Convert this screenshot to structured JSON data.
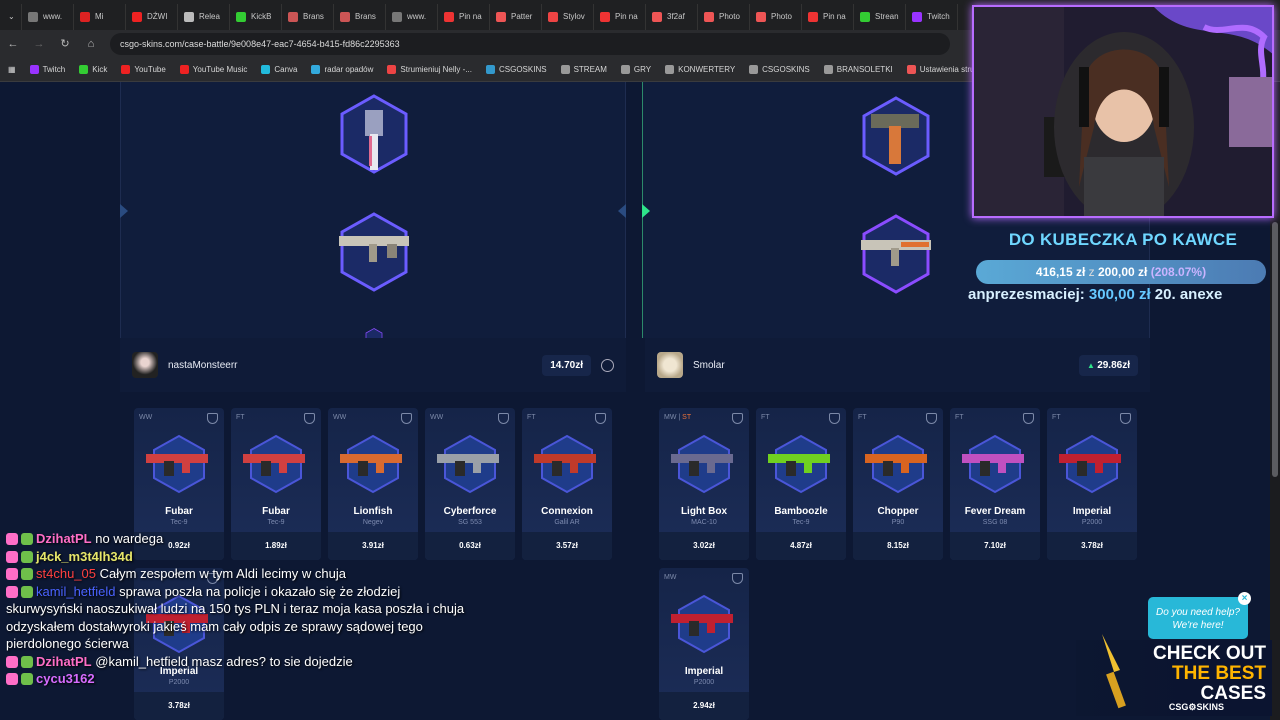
{
  "browser": {
    "tabs": [
      {
        "label": "www.",
        "color": "#777"
      },
      {
        "label": "Mi",
        "color": "#d22"
      },
      {
        "label": "DŹWI",
        "color": "#e22"
      },
      {
        "label": "Relea",
        "color": "#bbb"
      },
      {
        "label": "KickB",
        "color": "#3c3"
      },
      {
        "label": "Brans",
        "color": "#c55"
      },
      {
        "label": "Brans",
        "color": "#c55"
      },
      {
        "label": "www.",
        "color": "#777"
      },
      {
        "label": "Pin na",
        "color": "#e33"
      },
      {
        "label": "Patter",
        "color": "#e55"
      },
      {
        "label": "Stylov",
        "color": "#e44"
      },
      {
        "label": "Pin na",
        "color": "#e33"
      },
      {
        "label": "3f2af",
        "color": "#e55"
      },
      {
        "label": "Photo",
        "color": "#e55"
      },
      {
        "label": "Photo",
        "color": "#e55"
      },
      {
        "label": "Pin na",
        "color": "#e33"
      },
      {
        "label": "Strean",
        "color": "#3c3"
      },
      {
        "label": "Twitch",
        "color": "#93f"
      }
    ],
    "url": "csgo-skins.com/case-battle/9e008e47-eac7-4654-b415-fd86c2295363",
    "bookmarks": [
      {
        "label": "Twitch",
        "color": "#93f"
      },
      {
        "label": "Kick",
        "color": "#3c3"
      },
      {
        "label": "YouTube",
        "color": "#e22"
      },
      {
        "label": "YouTube Music",
        "color": "#e22"
      },
      {
        "label": "Canva",
        "color": "#2bd"
      },
      {
        "label": "radar opadów",
        "color": "#3ad"
      },
      {
        "label": "Strumieniuj Nelly -...",
        "color": "#e44"
      },
      {
        "label": "CSGOSKINS",
        "color": "#39c"
      },
      {
        "label": "STREAM",
        "color": "#999"
      },
      {
        "label": "GRY",
        "color": "#999"
      },
      {
        "label": "KONWERTERY",
        "color": "#999"
      },
      {
        "label": "CSGOSKINS",
        "color": "#999"
      },
      {
        "label": "BRANSOLETKI",
        "color": "#999"
      },
      {
        "label": "Ustawienia strumien...",
        "color": "#e55"
      }
    ]
  },
  "players": [
    {
      "name": "nastaMonsteerr",
      "total": "14.70zł",
      "items": [
        {
          "cond": "WW",
          "st": "",
          "name": "Fubar",
          "sub": "Tec-9",
          "price": "0.92zł",
          "accent": "#d04040"
        },
        {
          "cond": "FT",
          "st": "",
          "name": "Fubar",
          "sub": "Tec-9",
          "price": "1.89zł",
          "accent": "#d04040"
        },
        {
          "cond": "WW",
          "st": "",
          "name": "Lionfish",
          "sub": "Negev",
          "price": "3.91zł",
          "accent": "#d86a30"
        },
        {
          "cond": "WW",
          "st": "",
          "name": "Cyberforce",
          "sub": "SG 553",
          "price": "0.63zł",
          "accent": "#9aa0a8"
        },
        {
          "cond": "FT",
          "st": "",
          "name": "Connexion",
          "sub": "Galil AR",
          "price": "3.57zł",
          "accent": "#c03a2a"
        },
        {
          "cond": "",
          "st": "",
          "name": "Imperial",
          "sub": "P2000",
          "price": "3.78zł",
          "accent": "#c02030"
        }
      ]
    },
    {
      "name": "Smolar",
      "total": "29.86zł",
      "items": [
        {
          "cond": "MW | ",
          "st": "ST",
          "name": "Light Box",
          "sub": "MAC-10",
          "price": "3.02zł",
          "accent": "#6a6a90"
        },
        {
          "cond": "FT",
          "st": "",
          "name": "Bamboozle",
          "sub": "Tec-9",
          "price": "4.87zł",
          "accent": "#70d020"
        },
        {
          "cond": "FT",
          "st": "",
          "name": "Chopper",
          "sub": "P90",
          "price": "8.15zł",
          "accent": "#d86420"
        },
        {
          "cond": "FT",
          "st": "",
          "name": "Fever Dream",
          "sub": "SSG 08",
          "price": "7.10zł",
          "accent": "#c050c0"
        },
        {
          "cond": "FT",
          "st": "",
          "name": "Imperial",
          "sub": "P2000",
          "price": "3.78zł",
          "accent": "#c02030"
        },
        {
          "cond": "MW",
          "st": "",
          "name": "Imperial",
          "sub": "P2000",
          "price": "2.94zł",
          "accent": "#c02030"
        }
      ]
    }
  ],
  "stream": {
    "goal_title": "DO KUBECZKA PO KAWCE",
    "goal_current": "416,15 zł",
    "goal_sep": "z",
    "goal_target": "200,00 zł",
    "goal_pct": "(208.07%)",
    "goal_fraction": 1.0,
    "ticker_name": "anprezesmaciej:",
    "ticker_amount": "300,00 zł",
    "ticker_next": "20.",
    "ticker_next_name": "anexe"
  },
  "chat": [
    {
      "user": "DzihatPL",
      "msg": "no wardega",
      "cls": "u1"
    },
    {
      "user": "j4ck_m3t4lh34d",
      "msg": "",
      "cls": "u2"
    },
    {
      "user": "st4chu_05",
      "msg": "Całym zespołem w tym Aldi lecimy w chuja",
      "cls": "u3"
    },
    {
      "user": "kamil_hetfield",
      "msg": "sprawa poszła na policje i okazało się że złodziej skurwysyński naoszukiwał ludzi na 150 tys PLN i teraz moja kasa poszła i chuja odzyskałem dostałwyroki jakieś mam cały odpis ze sprawy sądowej tego pierdolonego ścierwa",
      "cls": "u4"
    },
    {
      "user": "DzihatPL",
      "msg": "@kamil_hetfield masz adres? to sie dojedzie",
      "cls": "u1"
    },
    {
      "user": "cycu3162",
      "msg": "",
      "cls": "u5"
    }
  ],
  "help": {
    "line1": "Do you need help?",
    "line2": "We're here!",
    "close": "×"
  },
  "promo": {
    "line1": "CHECK OUT",
    "line2": "THE BEST",
    "line3": "CASES",
    "logo": "CSG⚙SKINS"
  }
}
